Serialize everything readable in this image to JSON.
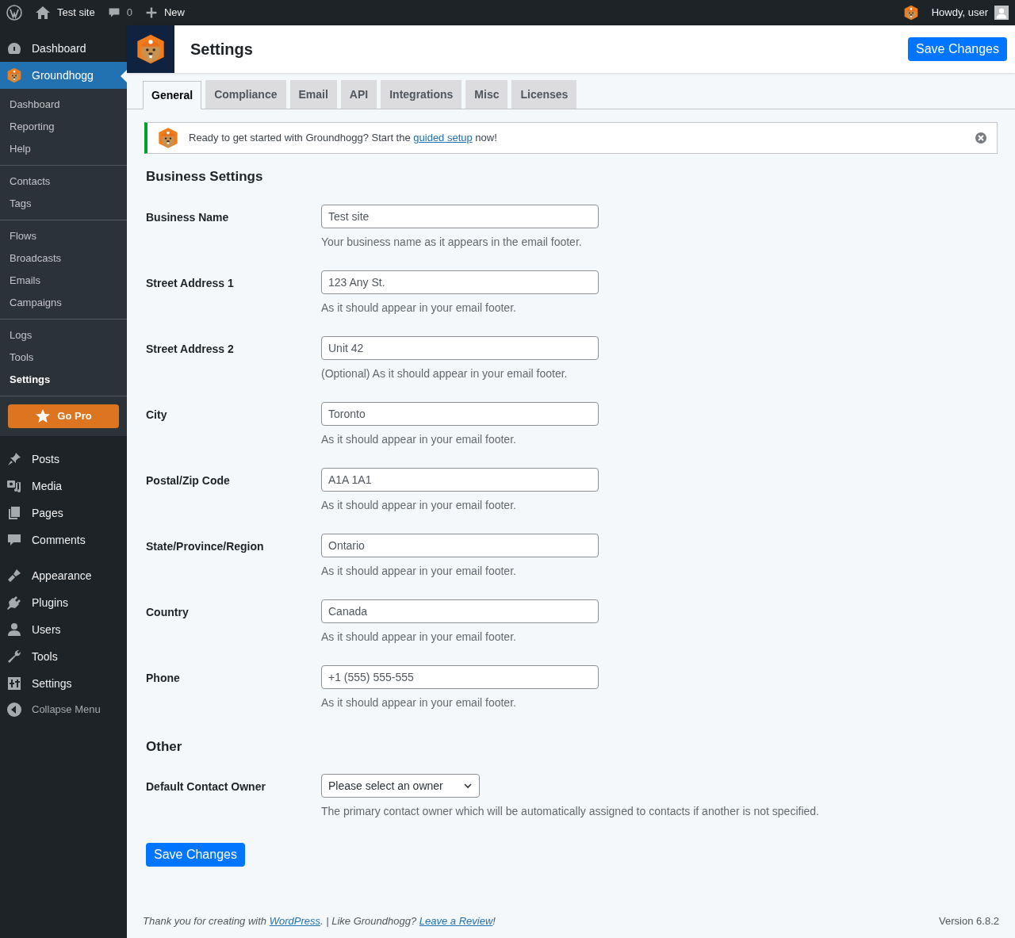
{
  "admin_bar": {
    "site": "Test site",
    "comments": "0",
    "new": "New",
    "greeting": "Howdy, user"
  },
  "sidebar": {
    "top": [
      {
        "label": "Dashboard",
        "selected": false
      },
      {
        "label": "Groundhogg",
        "selected": true
      }
    ],
    "submenu": [
      [
        {
          "label": "Dashboard",
          "selected": false
        },
        {
          "label": "Reporting",
          "selected": false
        },
        {
          "label": "Help",
          "selected": false
        }
      ],
      [
        {
          "label": "Contacts",
          "selected": false
        },
        {
          "label": "Tags",
          "selected": false
        }
      ],
      [
        {
          "label": "Flows",
          "selected": false
        },
        {
          "label": "Broadcasts",
          "selected": false
        },
        {
          "label": "Emails",
          "selected": false
        },
        {
          "label": "Campaigns",
          "selected": false
        }
      ],
      [
        {
          "label": "Logs",
          "selected": false
        },
        {
          "label": "Tools",
          "selected": false
        },
        {
          "label": "Settings",
          "selected": true
        }
      ]
    ],
    "go_pro": "Go Pro",
    "menu": [
      [
        {
          "label": "Posts"
        },
        {
          "label": "Media"
        },
        {
          "label": "Pages"
        },
        {
          "label": "Comments"
        }
      ],
      [
        {
          "label": "Appearance"
        },
        {
          "label": "Plugins"
        },
        {
          "label": "Users"
        },
        {
          "label": "Tools"
        },
        {
          "label": "Settings"
        }
      ]
    ],
    "collapse": "Collapse Menu"
  },
  "header": {
    "title": "Settings",
    "save": "Save Changes"
  },
  "tabs": [
    {
      "label": "General",
      "selected": true
    },
    {
      "label": "Compliance",
      "selected": false
    },
    {
      "label": "Email",
      "selected": false
    },
    {
      "label": "API",
      "selected": false
    },
    {
      "label": "Integrations",
      "selected": false
    },
    {
      "label": "Misc",
      "selected": false
    },
    {
      "label": "Licenses",
      "selected": false
    }
  ],
  "notice": {
    "before": "Ready to get started with Groundhogg? Start the",
    "link": "guided setup",
    "after": "now!"
  },
  "sections": [
    {
      "title": "Business Settings",
      "fields": [
        {
          "kind": "text",
          "label": "Business Name",
          "value": "Test site",
          "help": "Your business name as it appears in the email footer."
        },
        {
          "kind": "text",
          "label": "Street Address 1",
          "value": "123 Any St.",
          "help": "As it should appear in your email footer."
        },
        {
          "kind": "text",
          "label": "Street Address 2",
          "value": "Unit 42",
          "help": "(Optional) As it should appear in your email footer."
        },
        {
          "kind": "text",
          "label": "City",
          "value": "Toronto",
          "help": "As it should appear in your email footer."
        },
        {
          "kind": "text",
          "label": "Postal/Zip Code",
          "value": "A1A 1A1",
          "help": "As it should appear in your email footer."
        },
        {
          "kind": "text",
          "label": "State/Province/Region",
          "value": "Ontario",
          "help": "As it should appear in your email footer."
        },
        {
          "kind": "text",
          "label": "Country",
          "value": "Canada",
          "help": "As it should appear in your email footer."
        },
        {
          "kind": "text",
          "label": "Phone",
          "value": "+1 (555) 555-555",
          "help": "As it should appear in your email footer."
        }
      ]
    },
    {
      "title": "Other",
      "fields": [
        {
          "kind": "select",
          "label": "Default Contact Owner",
          "value": "Please select an owner",
          "help": "The primary contact owner which will be automatically assigned to contacts if another is not specified."
        }
      ]
    }
  ],
  "save_button": "Save Changes",
  "footer": {
    "before": "Thank you for creating with",
    "link1": "WordPress",
    "middle": ". | Like Groundhogg?",
    "link2": "Leave a Review",
    "after": "!",
    "version": "Version 6.8.2"
  }
}
